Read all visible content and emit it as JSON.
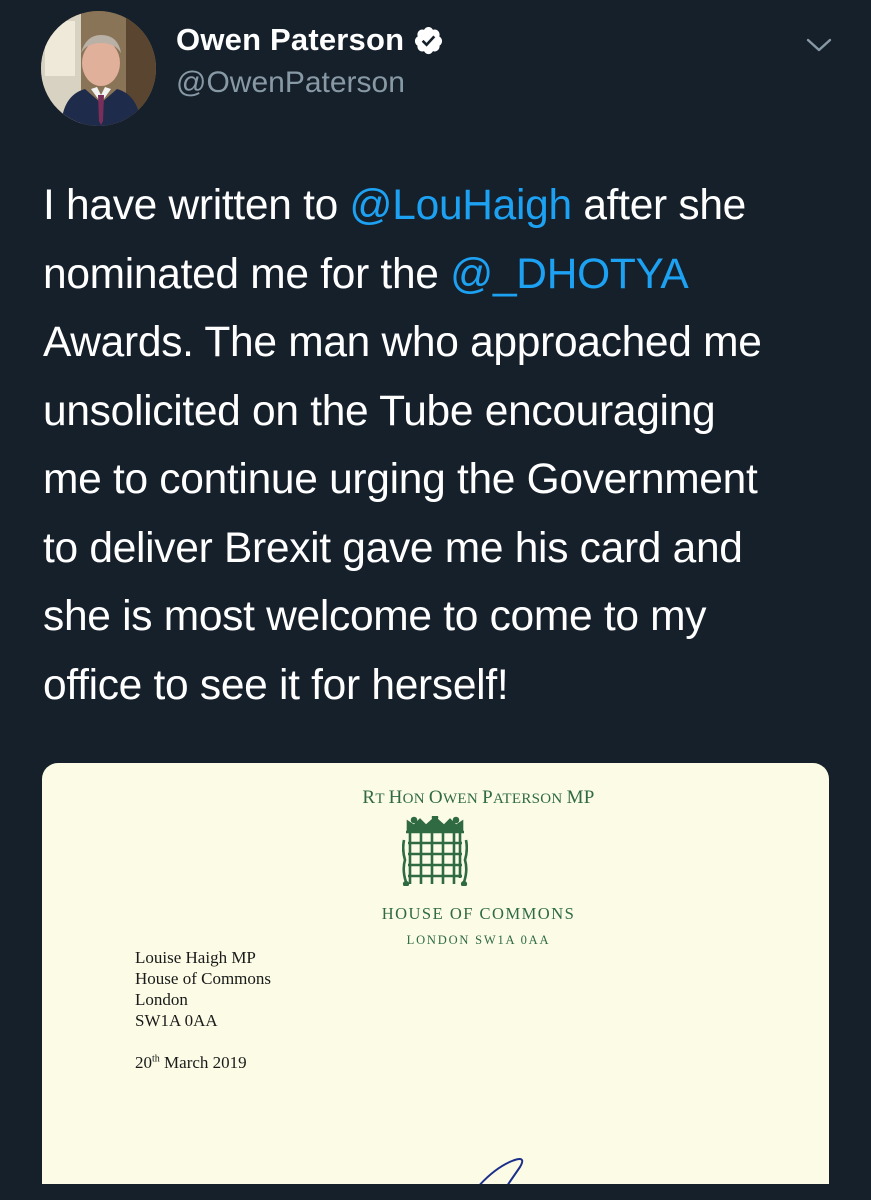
{
  "author": {
    "display_name": "Owen Paterson",
    "handle": "@OwenPaterson",
    "verified": true,
    "avatar_icon": "profile-photo"
  },
  "menu_icon": "chevron-down-icon",
  "tweet": {
    "lines": [
      [
        {
          "text": "I have written to "
        },
        {
          "text": "@LouHaigh",
          "mention": true
        },
        {
          "text": " after she"
        }
      ],
      [
        {
          "text": "nominated me for the "
        },
        {
          "text": "@_DHOTYA",
          "mention": true
        }
      ],
      [
        {
          "text": "Awards. The man who approached me"
        }
      ],
      [
        {
          "text": "unsolicited on the Tube encouraging"
        }
      ],
      [
        {
          "text": "me to continue urging the Government"
        }
      ],
      [
        {
          "text": "to deliver Brexit gave me his card and"
        }
      ],
      [
        {
          "text": "she is most welcome to come to my"
        }
      ],
      [
        {
          "text": "office to see it for herself!"
        }
      ]
    ]
  },
  "letter": {
    "letterhead_parts": [
      {
        "text": "R",
        "small": false
      },
      {
        "text": "T ",
        "small": true
      },
      {
        "text": "H",
        "small": false
      },
      {
        "text": "ON ",
        "small": true
      },
      {
        "text": "O",
        "small": false
      },
      {
        "text": "WEN ",
        "small": true
      },
      {
        "text": "P",
        "small": false
      },
      {
        "text": "ATERSON ",
        "small": true
      },
      {
        "text": "MP",
        "small": false
      }
    ],
    "house": "HOUSE OF COMMONS",
    "house_address": "LONDON SW1A 0AA",
    "recipient": [
      "Louise Haigh MP",
      "House of Commons",
      "London",
      "SW1A 0AA"
    ],
    "date_day": "20",
    "date_suffix": "th",
    "date_rest": " March 2019"
  },
  "colors": {
    "background": "#15202b",
    "text": "#ffffff",
    "secondary": "#8899a6",
    "link": "#1da1f2",
    "letter_paper": "#fbfbe6",
    "letterhead_green": "#2f6a43"
  }
}
